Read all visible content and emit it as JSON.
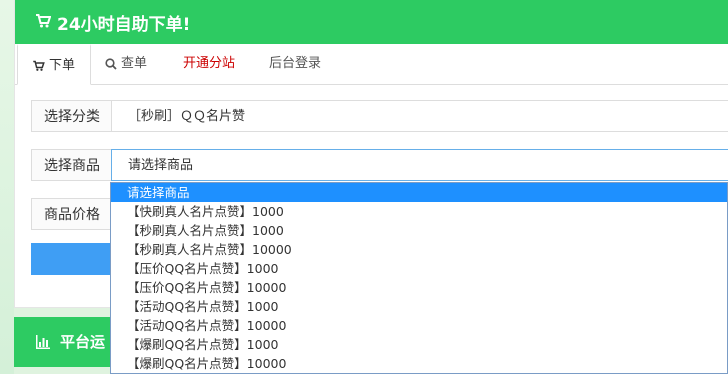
{
  "header": {
    "title": "24小时自助下单!"
  },
  "tabs": [
    {
      "label": "下单",
      "icon": "cart-icon"
    },
    {
      "label": "查单",
      "icon": "search-icon"
    },
    {
      "label": "开通分站",
      "color": "#cc0000"
    },
    {
      "label": "后台登录"
    }
  ],
  "form": {
    "category_label": "选择分类",
    "category_value": "［秒刷］ＱＱ名片赞",
    "product_label": "选择商品",
    "product_value": "请选择商品",
    "price_label": "商品价格"
  },
  "stats": {
    "title": "平台运"
  },
  "dropdown": {
    "options": [
      "请选择商品",
      "【快刷真人名片点赞】1000",
      "【秒刷真人名片点赞】1000",
      "【秒刷真人名片点赞】10000",
      "【压价QQ名片点赞】1000",
      "【压价QQ名片点赞】10000",
      "【活动QQ名片点赞】1000",
      "【活动QQ名片点赞】10000",
      "【爆刷QQ名片点赞】1000",
      "【爆刷QQ名片点赞】10000"
    ]
  },
  "colors": {
    "brand_green": "#2dcb62",
    "submit_blue": "#3f9ef4",
    "selected_blue": "#1e90ff",
    "link_red": "#cc0000"
  }
}
